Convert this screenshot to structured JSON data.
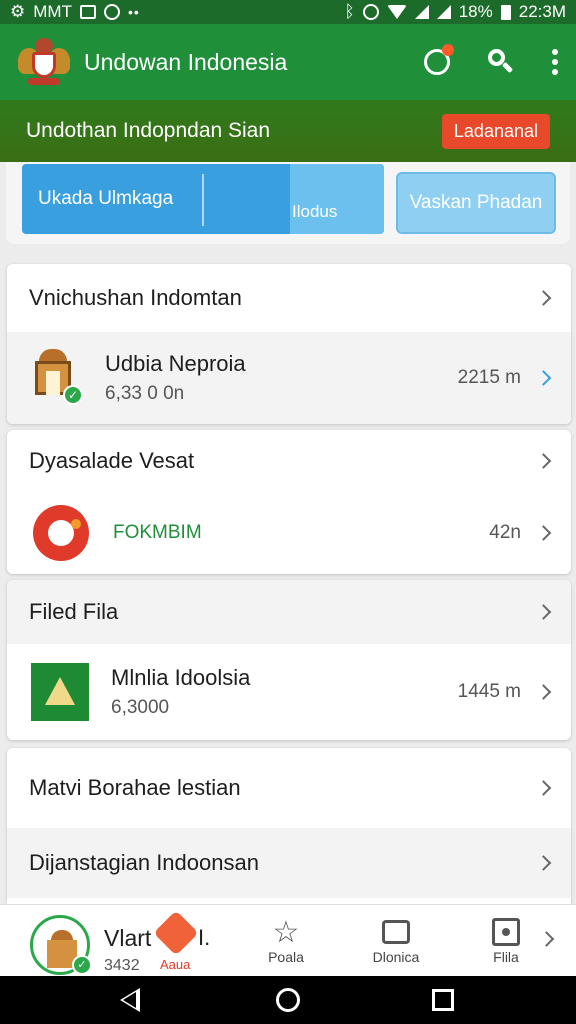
{
  "status_bar": {
    "left_text": "MMT",
    "battery": "18%",
    "time": "22:3M"
  },
  "app_bar": {
    "title": "Undowan Indonesia"
  },
  "banner": {
    "text": "Undothan Indopndan Sian",
    "button_label": "Ladananal"
  },
  "tabs": {
    "primary_label": "Ukada Ulmkaga",
    "primary_secondary_label": "Ilodus",
    "alt_label": "Vaskan Phadan"
  },
  "sections": [
    {
      "header": "Vnichushan Indomtan",
      "item": {
        "title": "Udbia Neproia",
        "value": "6,33 0 0n",
        "meta": "2215 m"
      }
    },
    {
      "header": "Dyasalade Vesat",
      "item": {
        "title": "FOKMBIM",
        "meta": "42n"
      }
    },
    {
      "header": "Filed Fila",
      "item": {
        "title": "Mlnlia Idoolsia",
        "value": "6,3000",
        "meta": "1445 m"
      }
    },
    {
      "header": "Matvi  Borahae lestian"
    },
    {
      "header": "Dijanstagian Indoonsan"
    }
  ],
  "bottom_bar": {
    "title": "Vlart",
    "subtitle": "3432",
    "badge_text": "I.",
    "badge_sub": "Aaua",
    "nav": [
      {
        "label": "Poala"
      },
      {
        "label": "Dlonica"
      },
      {
        "label": "Flila"
      }
    ]
  },
  "colors": {
    "app_bar": "#1f8f3a",
    "banner": "#3b6e14",
    "accent_blue": "#3a9fdf",
    "banner_button": "#e8492b"
  }
}
